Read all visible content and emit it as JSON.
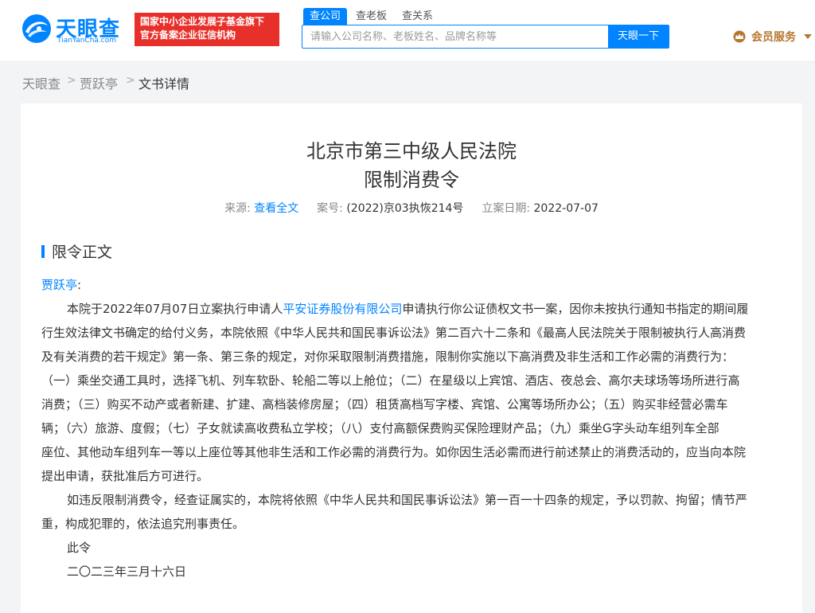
{
  "header": {
    "logo_text": "天眼查",
    "logo_sub": "TianYanCha.com",
    "banner_line1": "国家中小企业发展子基金旗下",
    "banner_line2": "官方备案企业征信机构",
    "tabs": [
      "查公司",
      "查老板",
      "查关系"
    ],
    "search_placeholder": "请输入公司名称、老板姓名、品牌名称等",
    "search_button": "天眼一下",
    "member_label": "会员服务",
    "colors": {
      "brand_blue": "#0084ff",
      "banner_red": "#e8302a",
      "member_gold": "#b5772e"
    }
  },
  "breadcrumb": {
    "items": [
      "天眼查",
      "贾跃亭",
      "文书详情"
    ],
    "separator": ">"
  },
  "document": {
    "court": "北京市第三中级人民法院",
    "doc_type": "限制消费令",
    "source_label": "来源:",
    "source_link": "查看全文",
    "case_label": "案号:",
    "case_no": "(2022)京03执恢214号",
    "date_label": "立案日期:",
    "filing_date": "2022-07-07",
    "section_title": "限令正文",
    "addressee": "贾跃亭",
    "addressee_colon": ":",
    "p1_l1_before": "本院于2022年07月07日立案执行申请人",
    "applicant": "平安证券股份有限公司",
    "p1_l1_after": "申请执行你公证债权文书一案，因你未按执行通知书指定的期间履",
    "p1_l2": "行生效法律文书确定的给付义务，本院依照《中华人民共和国民事诉讼法》第二百六十二条和《最高人民法院关于限制被执行人高消费",
    "p1_l3": "及有关消费的若干规定》第一条、第三条的规定，对你采取限制消费措施，限制你实施以下高消费及非生活和工作必需的消费行为：",
    "p1_l4": "（一）乘坐交通工具时，选择飞机、列车软卧、轮船二等以上舱位；（二）在星级以上宾馆、酒店、夜总会、高尔夫球场等场所进行高",
    "p1_l5": "消费；（三）购买不动产或者新建、扩建、高档装修房屋；（四）租赁高档写字楼、宾馆、公寓等场所办公；（五）购买非经营必需车",
    "p1_l6": "辆；（六）旅游、度假；（七）子女就读高收费私立学校；（八）支付高额保费购买保险理财产品；（九）乘坐G字头动车组列车全部",
    "p1_l7": "座位、其他动车组列车一等以上座位等其他非生活和工作必需的消费行为。如你因生活必需而进行前述禁止的消费活动的，应当向本院",
    "p1_l8": "提出申请，获批准后方可进行。",
    "p2_l1": "如违反限制消费令，经查证属实的，本院将依照《中华人民共和国民事诉讼法》第一百一十四条的规定，予以罚款、拘留；情节严",
    "p2_l2": "重，构成犯罪的，依法追究刑事责任。",
    "closing": "此令",
    "sign_date": "二〇二三年三月十六日"
  }
}
